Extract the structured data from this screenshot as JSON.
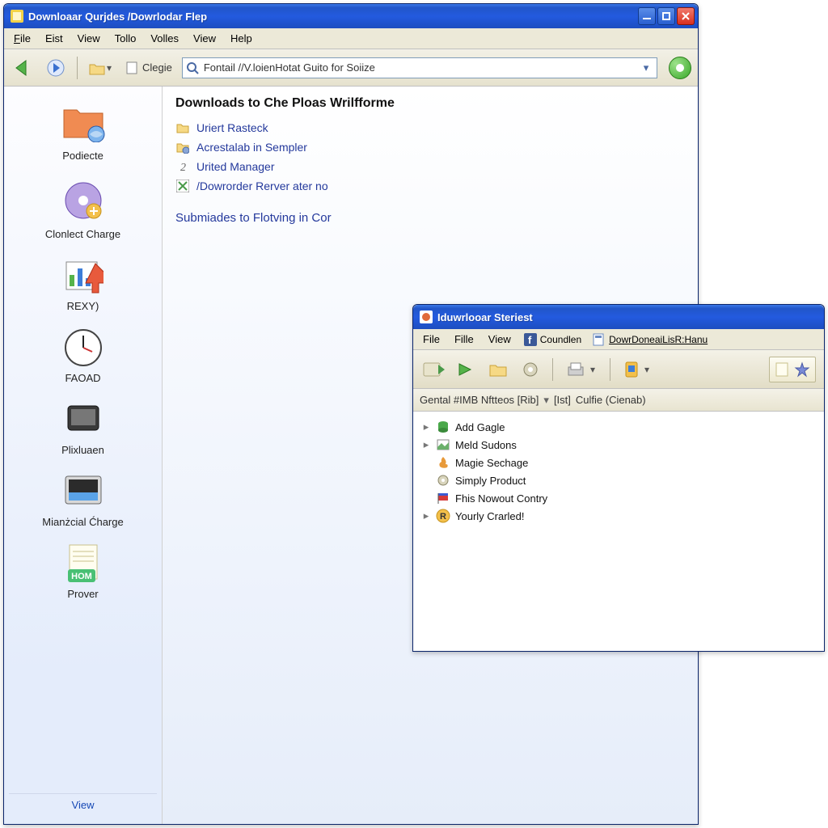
{
  "win1": {
    "title": "Downloaar Qurjdes  /Dowrlodar Flep",
    "menubar": [
      "File",
      "Eist",
      "View",
      "Tollo",
      "Volles",
      "View",
      "Help"
    ],
    "toolbar": {
      "clegie_label": "Clegie"
    },
    "address": {
      "text": "Fontail //V.loienHotat Guito for Soiize"
    },
    "sidebar": {
      "items": [
        {
          "label": "Podiecte"
        },
        {
          "label": "Clonlect Charge"
        },
        {
          "label": "REXY)"
        },
        {
          "label": "FAOAD"
        },
        {
          "label": "Plixluaen"
        },
        {
          "label": "Mianżcial Ćharge"
        },
        {
          "label": "Prover"
        }
      ],
      "footer": "View"
    },
    "content": {
      "heading": "Downloads to Che Ploas Wrilfforme",
      "links": [
        "Uriert Rasteck",
        "Acrestalab in Sempler",
        "Urited Manager",
        "/Dowrorder Rerver ater no"
      ],
      "subheading": "Submiades to Flotving in Cor"
    }
  },
  "win2": {
    "title": "Iduwrlooar Steriest",
    "menubar": {
      "items": [
        "File",
        "Fille",
        "View"
      ],
      "btn1": "Coundlen",
      "btn2": "DowrDoneaiLisR:Hanu"
    },
    "breadcrumb": {
      "a": "Gental  #IMB  Nftteos  [Rib]",
      "b": "[Ist]",
      "c": "Culfie  (Cienab)"
    },
    "tree": [
      {
        "exp": true,
        "label": "Add Gagle"
      },
      {
        "exp": true,
        "label": "Meld Sudons"
      },
      {
        "exp": false,
        "label": "Magie Sechage"
      },
      {
        "exp": false,
        "label": "Simply Product"
      },
      {
        "exp": false,
        "label": "Fhis Nowout Contry"
      },
      {
        "exp": true,
        "label": "Yourly Crarled!"
      }
    ]
  }
}
